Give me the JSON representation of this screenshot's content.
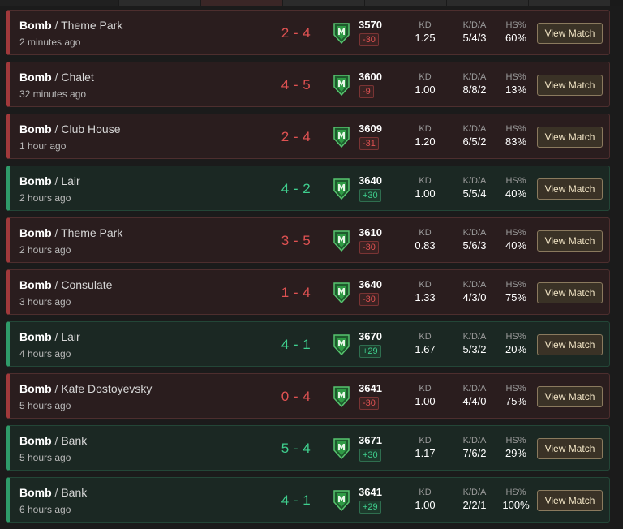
{
  "matches": [
    {
      "result": "loss",
      "mode": "Bomb",
      "map": "Theme Park",
      "time": "2 minutes ago",
      "score": "2 - 4",
      "elo": "3570",
      "delta": "-30",
      "kd": "1.25",
      "kda": "5/4/3",
      "hs": "60%"
    },
    {
      "result": "loss",
      "mode": "Bomb",
      "map": "Chalet",
      "time": "32 minutes ago",
      "score": "4 - 5",
      "elo": "3600",
      "delta": "-9",
      "kd": "1.00",
      "kda": "8/8/2",
      "hs": "13%"
    },
    {
      "result": "loss",
      "mode": "Bomb",
      "map": "Club House",
      "time": "1 hour ago",
      "score": "2 - 4",
      "elo": "3609",
      "delta": "-31",
      "kd": "1.20",
      "kda": "6/5/2",
      "hs": "83%"
    },
    {
      "result": "win",
      "mode": "Bomb",
      "map": "Lair",
      "time": "2 hours ago",
      "score": "4 - 2",
      "elo": "3640",
      "delta": "+30",
      "kd": "1.00",
      "kda": "5/5/4",
      "hs": "40%"
    },
    {
      "result": "loss",
      "mode": "Bomb",
      "map": "Theme Park",
      "time": "2 hours ago",
      "score": "3 - 5",
      "elo": "3610",
      "delta": "-30",
      "kd": "0.83",
      "kda": "5/6/3",
      "hs": "40%"
    },
    {
      "result": "loss",
      "mode": "Bomb",
      "map": "Consulate",
      "time": "3 hours ago",
      "score": "1 - 4",
      "elo": "3640",
      "delta": "-30",
      "kd": "1.33",
      "kda": "4/3/0",
      "hs": "75%"
    },
    {
      "result": "win",
      "mode": "Bomb",
      "map": "Lair",
      "time": "4 hours ago",
      "score": "4 - 1",
      "elo": "3670",
      "delta": "+29",
      "kd": "1.67",
      "kda": "5/3/2",
      "hs": "20%"
    },
    {
      "result": "loss",
      "mode": "Bomb",
      "map": "Kafe Dostoyevsky",
      "time": "5 hours ago",
      "score": "0 - 4",
      "elo": "3641",
      "delta": "-30",
      "kd": "1.00",
      "kda": "4/4/0",
      "hs": "75%"
    },
    {
      "result": "win",
      "mode": "Bomb",
      "map": "Bank",
      "time": "5 hours ago",
      "score": "5 - 4",
      "elo": "3671",
      "delta": "+30",
      "kd": "1.17",
      "kda": "7/6/2",
      "hs": "29%"
    },
    {
      "result": "win",
      "mode": "Bomb",
      "map": "Bank",
      "time": "6 hours ago",
      "score": "4 - 1",
      "elo": "3641",
      "delta": "+29",
      "kd": "1.00",
      "kda": "2/2/1",
      "hs": "100%"
    }
  ],
  "labels": {
    "kd": "KD",
    "kda": "K/D/A",
    "hs": "HS%",
    "button": "View Match",
    "separator": " / "
  },
  "colors": {
    "loss": "#e05252",
    "win": "#3fcf8e",
    "rank_badge": "#2f9a45"
  },
  "icons": {
    "rank": "rank-badge-icon"
  }
}
